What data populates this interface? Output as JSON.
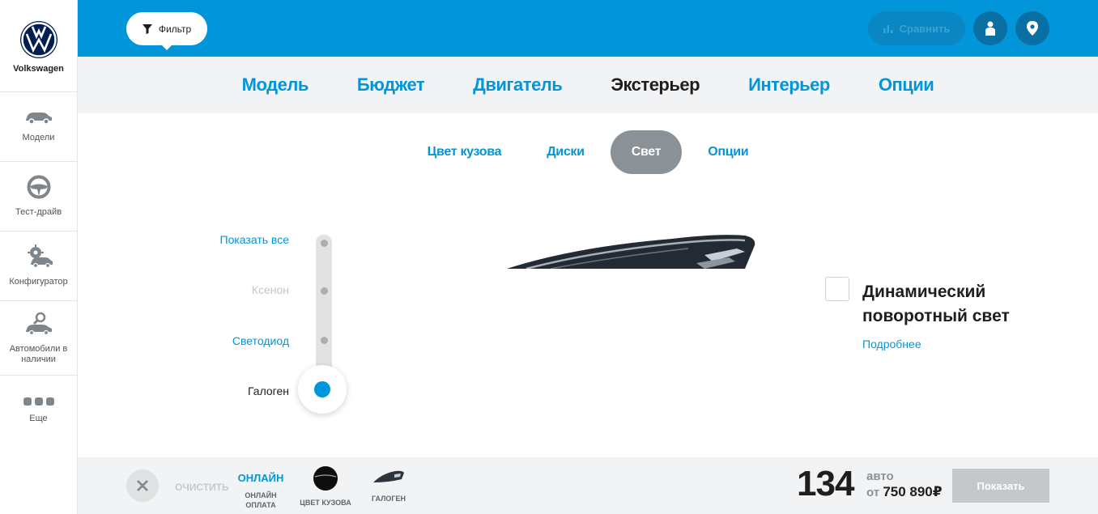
{
  "brand": {
    "name": "Volkswagen"
  },
  "sidebar": {
    "items": [
      {
        "label": "Модели",
        "icon": "car-icon"
      },
      {
        "label": "Тест-драйв",
        "icon": "steering-wheel-icon"
      },
      {
        "label": "Конфигуратор",
        "icon": "car-gear-icon"
      },
      {
        "label": "Автомобили в наличии",
        "icon": "car-search-icon"
      },
      {
        "label": "Еще",
        "icon": "more-dots-icon"
      }
    ]
  },
  "header": {
    "filter_label": "Фильтр",
    "compare_label": "Сравнить"
  },
  "main_tabs": [
    "Модель",
    "Бюджет",
    "Двигатель",
    "Экстерьер",
    "Интерьер",
    "Опции"
  ],
  "active_main_tab": "Экстерьер",
  "sub_tabs": [
    "Цвет кузова",
    "Диски",
    "Свет",
    "Опции"
  ],
  "active_sub_tab": "Свет",
  "light_filter": {
    "options": [
      "Показать все",
      "Ксенон",
      "Светодиод",
      "Галоген"
    ],
    "selected": "Галоген"
  },
  "option": {
    "checked": false,
    "title": "Динамический поворотный свет",
    "more_link": "Подробнее"
  },
  "footer": {
    "clear_label": "ОЧИСТИТЬ",
    "chips": [
      {
        "top": "ОНЛАЙН",
        "caption": "ОНЛАЙН ОПЛАТА"
      },
      {
        "caption": "ЦВЕТ КУЗОВА"
      },
      {
        "caption": "ГАЛОГЕН"
      }
    ],
    "count": "134",
    "count_unit": "авто",
    "price_prefix": "от",
    "price": "750 890₽",
    "show_label": "Показать"
  },
  "colors": {
    "accent": "#0096d9",
    "muted": "#8a9197",
    "sidebar_icon": "#7e868c"
  }
}
